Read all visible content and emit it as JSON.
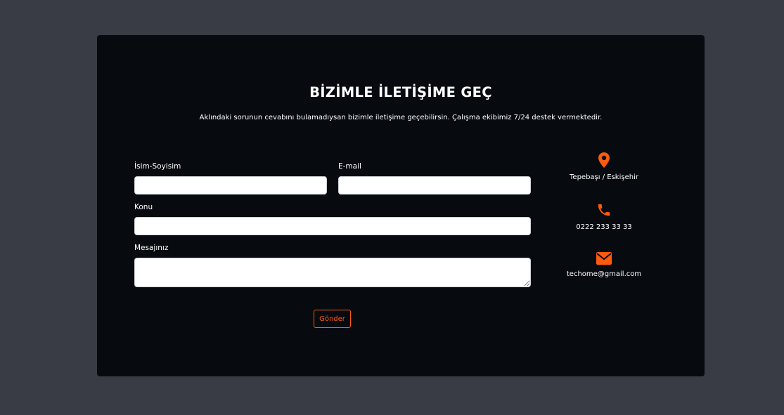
{
  "contact": {
    "title": "BİZİMLE İLETİŞİME GEÇ",
    "subtitle": "Aklındaki sorunun cevabını bulamadıysan bizimle iletişime geçebilirsin. Çalışma ekibimiz 7/24 destek vermektedir."
  },
  "form": {
    "name_label": "İsim-Soyisim",
    "name_value": "",
    "email_label": "E-mail",
    "email_value": "",
    "subject_label": "Konu",
    "subject_value": "",
    "message_label": "Mesajınız",
    "message_value": "",
    "submit_label": "Gönder"
  },
  "info": {
    "location": {
      "icon": "map-pin-icon",
      "text": "Tepebaşı / Eskişehir"
    },
    "phone": {
      "icon": "phone-icon",
      "text": "0222 233 33 33"
    },
    "email": {
      "icon": "envelope-icon",
      "text": "techome@gmail.com"
    }
  },
  "colors": {
    "accent": "#ff5a0e",
    "card_bg": "#070a0f",
    "page_bg": "#393c45"
  }
}
